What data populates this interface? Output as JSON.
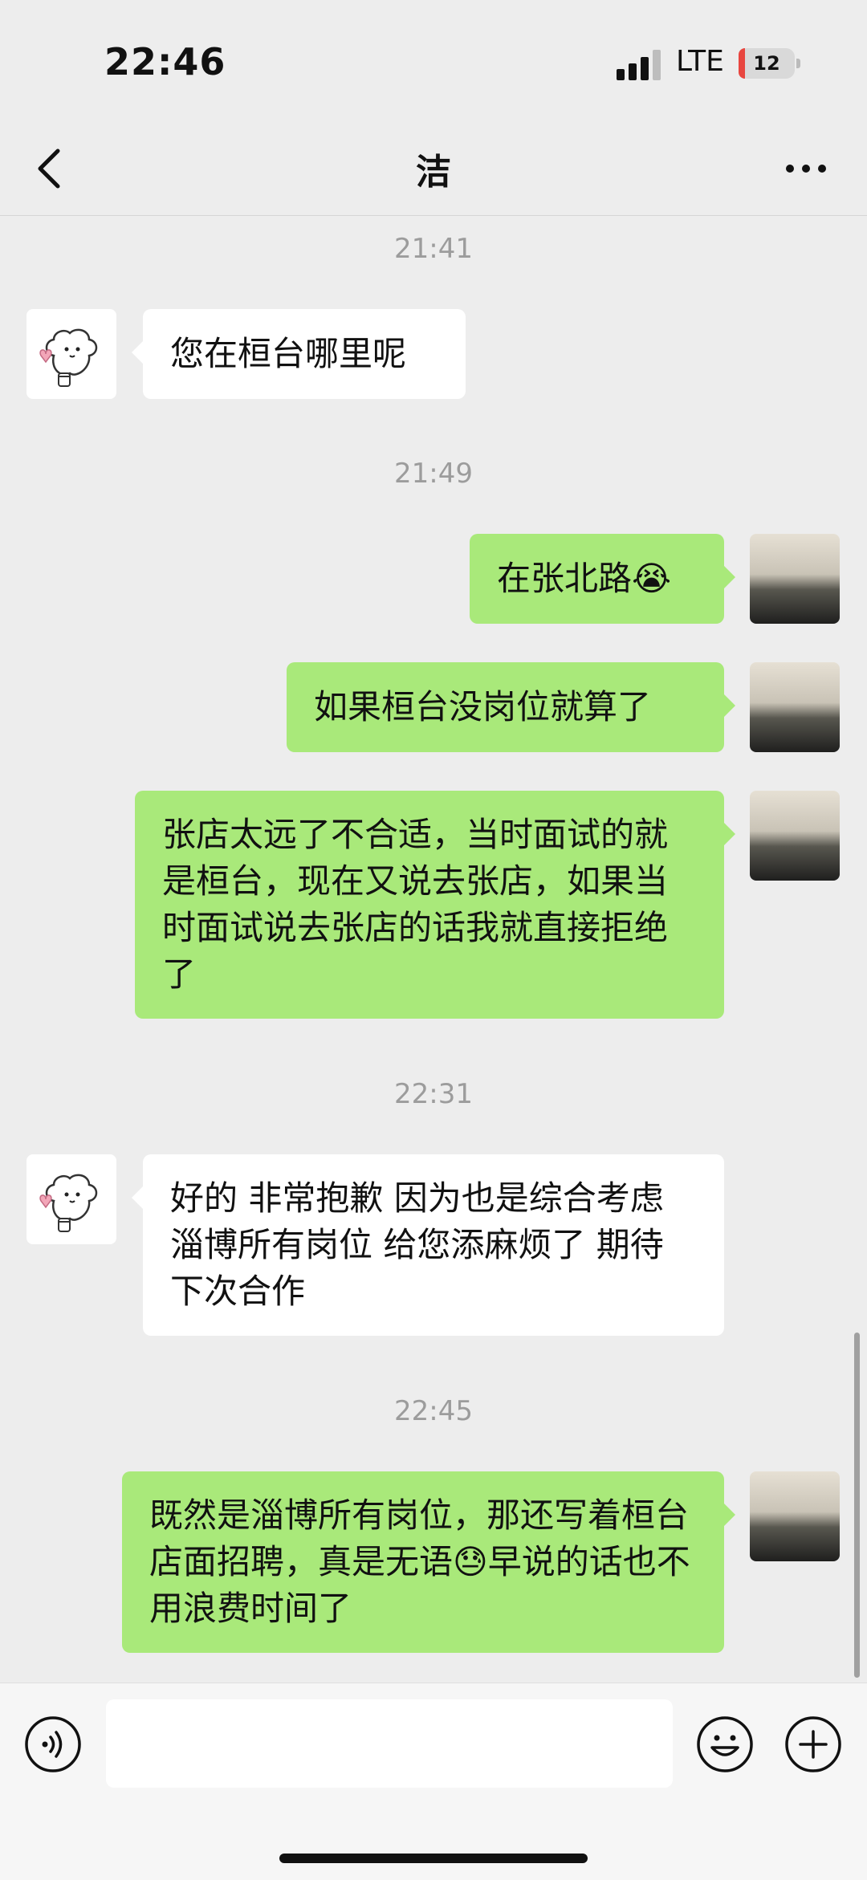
{
  "status_bar": {
    "time": "22:46",
    "network": "LTE",
    "battery": "12",
    "battery_level": 0.12,
    "battery_color": "#e8463f"
  },
  "nav": {
    "title": "洁",
    "back_icon": "chevron-left-icon",
    "more_icon": "more-dots-icon"
  },
  "messages": [
    {
      "type": "time",
      "text": "21:41"
    },
    {
      "type": "in",
      "text": "您在桓台哪里呢"
    },
    {
      "type": "time",
      "text": "21:49"
    },
    {
      "type": "out",
      "text": "在张北路😭"
    },
    {
      "type": "out",
      "text": "如果桓台没岗位就算了"
    },
    {
      "type": "out",
      "text": "张店太远了不合适，当时面试的就是桓台，现在又说去张店，如果当时面试说去张店的话我就直接拒绝了"
    },
    {
      "type": "time",
      "text": "22:31"
    },
    {
      "type": "in",
      "text": "好的  非常抱歉 因为也是综合考虑淄博所有岗位 给您添麻烦了 期待下次合作"
    },
    {
      "type": "time",
      "text": "22:45"
    },
    {
      "type": "out",
      "text": "既然是淄博所有岗位，那还写着桓台店面招聘，真是无语😓早说的话也不用浪费时间了"
    }
  ],
  "input_bar": {
    "voice_icon": "voice-icon",
    "emoji_icon": "emoji-icon",
    "add_icon": "plus-icon"
  },
  "colors": {
    "background": "#ededed",
    "outgoing_bubble": "#a9e97a",
    "incoming_bubble": "#ffffff"
  }
}
